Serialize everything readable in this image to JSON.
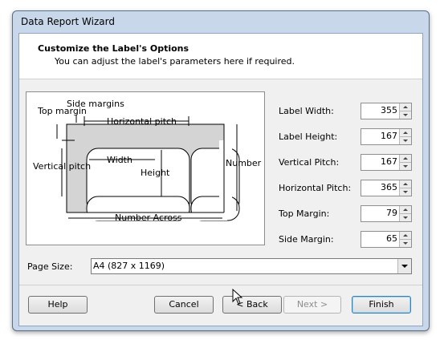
{
  "window": {
    "title": "Data Report Wizard"
  },
  "header": {
    "title": "Customize the Label's Options",
    "subtitle": "You can adjust the label's parameters here if required."
  },
  "diagram": {
    "top_margin": "Top margin",
    "side_margins": "Side margins",
    "horizontal_pitch": "Horizontal pitch",
    "vertical_pitch": "Vertical pitch",
    "width": "Width",
    "height": "Height",
    "number_down": "Number Down",
    "number_across": "Number Across"
  },
  "fields": [
    {
      "label": "Label Width:",
      "value": "355"
    },
    {
      "label": "Label Height:",
      "value": "167"
    },
    {
      "label": "Vertical Pitch:",
      "value": "167"
    },
    {
      "label": "Horizontal Pitch:",
      "value": "365"
    },
    {
      "label": "Top Margin:",
      "value": "79"
    },
    {
      "label": "Side Margin:",
      "value": "65"
    }
  ],
  "page_size": {
    "label": "Page Size:",
    "value": "A4 (827 x 1169)"
  },
  "buttons": {
    "help": "Help",
    "cancel": "Cancel",
    "back": "< Back",
    "next": "Next >",
    "finish": "Finish"
  },
  "icons": {
    "cursor": "mouse-pointer-icon"
  }
}
